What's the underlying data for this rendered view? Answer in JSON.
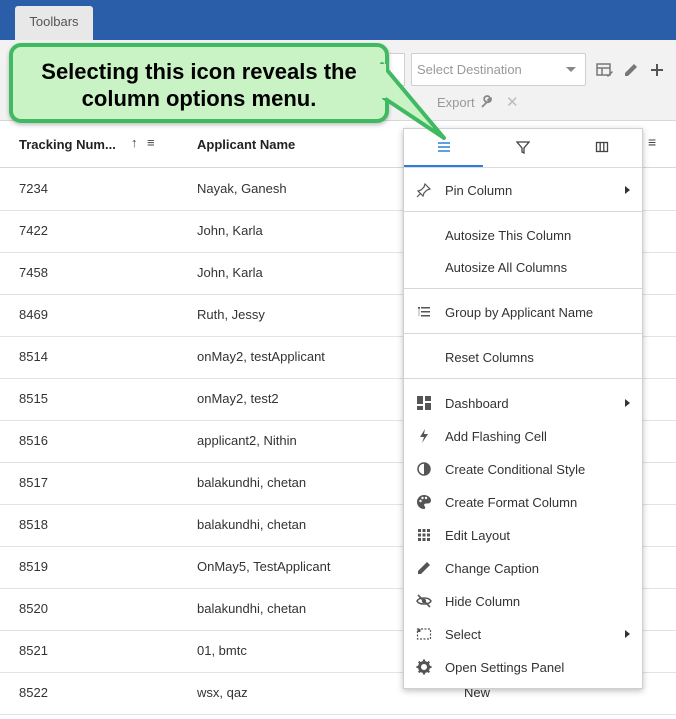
{
  "header": {
    "tab_label": "Toolbars"
  },
  "toolbar": {
    "destination_placeholder": "Select Destination",
    "export_label": "Export",
    "close_glyph": "✕",
    "icons": [
      "table-edit-icon",
      "pencil-icon",
      "plus-icon"
    ]
  },
  "callout": {
    "line1": "Selecting this icon reveals the",
    "line2": "column options menu."
  },
  "grid": {
    "columns": [
      "Tracking Num...",
      "Applicant Name"
    ],
    "rows": [
      {
        "tracking": "7234",
        "applicant": "Nayak, Ganesh"
      },
      {
        "tracking": "7422",
        "applicant": "John, Karla"
      },
      {
        "tracking": "7458",
        "applicant": "John, Karla"
      },
      {
        "tracking": "8469",
        "applicant": "Ruth, Jessy"
      },
      {
        "tracking": "8514",
        "applicant": "onMay2, testApplicant"
      },
      {
        "tracking": "8515",
        "applicant": "onMay2, test2"
      },
      {
        "tracking": "8516",
        "applicant": "applicant2, Nithin"
      },
      {
        "tracking": "8517",
        "applicant": "balakundhi, chetan"
      },
      {
        "tracking": "8518",
        "applicant": "balakundhi, chetan"
      },
      {
        "tracking": "8519",
        "applicant": "OnMay5, TestApplicant"
      },
      {
        "tracking": "8520",
        "applicant": "balakundhi, chetan"
      },
      {
        "tracking": "8521",
        "applicant": "01, bmtc"
      },
      {
        "tracking": "8522",
        "applicant": "wsx, qaz",
        "status": "New"
      }
    ]
  },
  "column_menu": {
    "tabs": [
      "menu-icon",
      "filter-icon",
      "columns-icon"
    ],
    "active_tab": "menu-icon",
    "active_color": "#2c7de0",
    "items": [
      {
        "label": "Pin Column",
        "icon": "pin-icon",
        "submenu": true
      },
      {
        "label": "Autosize This Column"
      },
      {
        "label": "Autosize All Columns"
      },
      {
        "label": "Group by Applicant Name",
        "icon": "group-icon"
      },
      {
        "label": "Reset Columns"
      },
      {
        "label": "Dashboard",
        "icon": "dashboard-icon",
        "submenu": true
      },
      {
        "label": "Add Flashing Cell",
        "icon": "lightning-icon"
      },
      {
        "label": "Create Conditional Style",
        "icon": "contrast-icon"
      },
      {
        "label": "Create Format Column",
        "icon": "palette-icon"
      },
      {
        "label": "Edit Layout",
        "icon": "grid-dots-icon"
      },
      {
        "label": "Change Caption",
        "icon": "pencil-icon"
      },
      {
        "label": "Hide Column",
        "icon": "eye-off-icon"
      },
      {
        "label": "Select",
        "icon": "select-icon",
        "submenu": true
      },
      {
        "label": "Open Settings Panel",
        "icon": "gear-icon"
      }
    ]
  },
  "colors": {
    "header_blue": "#2a5ea8",
    "callout_fill": "#c9f2c5",
    "callout_border": "#3fba62"
  }
}
